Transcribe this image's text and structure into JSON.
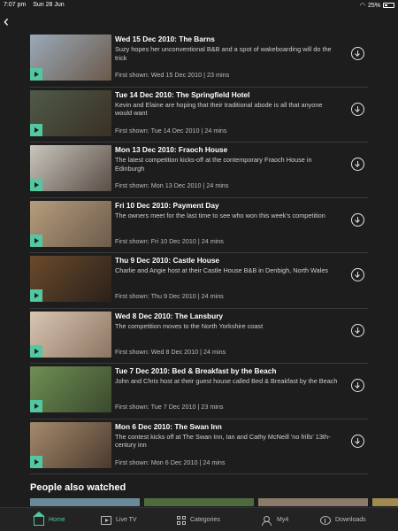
{
  "status_bar": {
    "time": "7:07 pm",
    "date": "Sun 28 Jun",
    "battery": "25%"
  },
  "colors": {
    "accent": "#52c7a2",
    "background": "#1d1d1d"
  },
  "episodes": [
    {
      "title": "Wed 15 Dec 2010: The Barns",
      "description": "Suzy hopes her unconventional B&B and a spot of wakeboarding will do the trick",
      "meta": "First shown: Wed 15 Dec 2010 | 23 mins",
      "thumb_colors": [
        "#9aa9b8",
        "#6b5a4a"
      ]
    },
    {
      "title": "Tue 14 Dec 2010: The Springfield Hotel",
      "description": "Kevin and Elaine are hoping that their traditional abode is all that anyone would want",
      "meta": "First shown: Tue 14 Dec 2010 | 24 mins",
      "thumb_colors": [
        "#4e5a48",
        "#3b3024"
      ]
    },
    {
      "title": "Mon 13 Dec 2010: Fraoch House",
      "description": "The latest competition kicks-off at the contemporary Fraoch House in Edinburgh",
      "meta": "First shown: Mon 13 Dec 2010 | 24 mins",
      "thumb_colors": [
        "#c9c6bd",
        "#5a4d46"
      ]
    },
    {
      "title": "Fri 10 Dec 2010: Payment Day",
      "description": "The owners meet for the last time to see who won this week's competition",
      "meta": "First shown: Fri 10 Dec 2010 | 24 mins",
      "thumb_colors": [
        "#b59c7d",
        "#6d5c4b"
      ]
    },
    {
      "title": "Thu 9 Dec 2010: Castle House",
      "description": "Charlie and Angie host at their Castle House B&B in Denbigh, North Wales",
      "meta": "First shown: Thu 9 Dec 2010 | 24 mins",
      "thumb_colors": [
        "#6b4a2c",
        "#2a211a"
      ]
    },
    {
      "title": "Wed 8 Dec 2010: The Lansbury",
      "description": "The competition moves to the North Yorkshire coast",
      "meta": "First shown: Wed 8 Dec 2010 | 24 mins",
      "thumb_colors": [
        "#d8c6b2",
        "#8c7562"
      ]
    },
    {
      "title": "Tue 7 Dec 2010: Bed & Breakfast by the Beach",
      "description": "John and Chris host at their guest house called Bed & Breakfast by the Beach",
      "meta": "First shown: Tue 7 Dec 2010 | 23 mins",
      "thumb_colors": [
        "#6f8f52",
        "#3a4a2e"
      ]
    },
    {
      "title": "Mon 6 Dec 2010: The Swan Inn",
      "description": "The contest kicks off at The Swan Inn, Ian and Cathy McNeill 'no frills' 13th-century inn",
      "meta": "First shown: Mon 6 Dec 2010 | 24 mins",
      "thumb_colors": [
        "#a58a6c",
        "#4a3a2e"
      ]
    }
  ],
  "people_also_watched": {
    "title": "People also watched",
    "thumb_colors": [
      "#6a8a9a",
      "#4f6b3e",
      "#8b7b6a",
      "#a08a50"
    ]
  },
  "tab_bar": {
    "items": [
      {
        "label": "Home",
        "icon": "home-icon",
        "active": true
      },
      {
        "label": "Live TV",
        "icon": "tv-icon",
        "active": false
      },
      {
        "label": "Categories",
        "icon": "categories-icon",
        "active": false
      },
      {
        "label": "My4",
        "icon": "user-icon",
        "active": false
      },
      {
        "label": "Downloads",
        "icon": "download-icon",
        "active": false
      }
    ]
  }
}
